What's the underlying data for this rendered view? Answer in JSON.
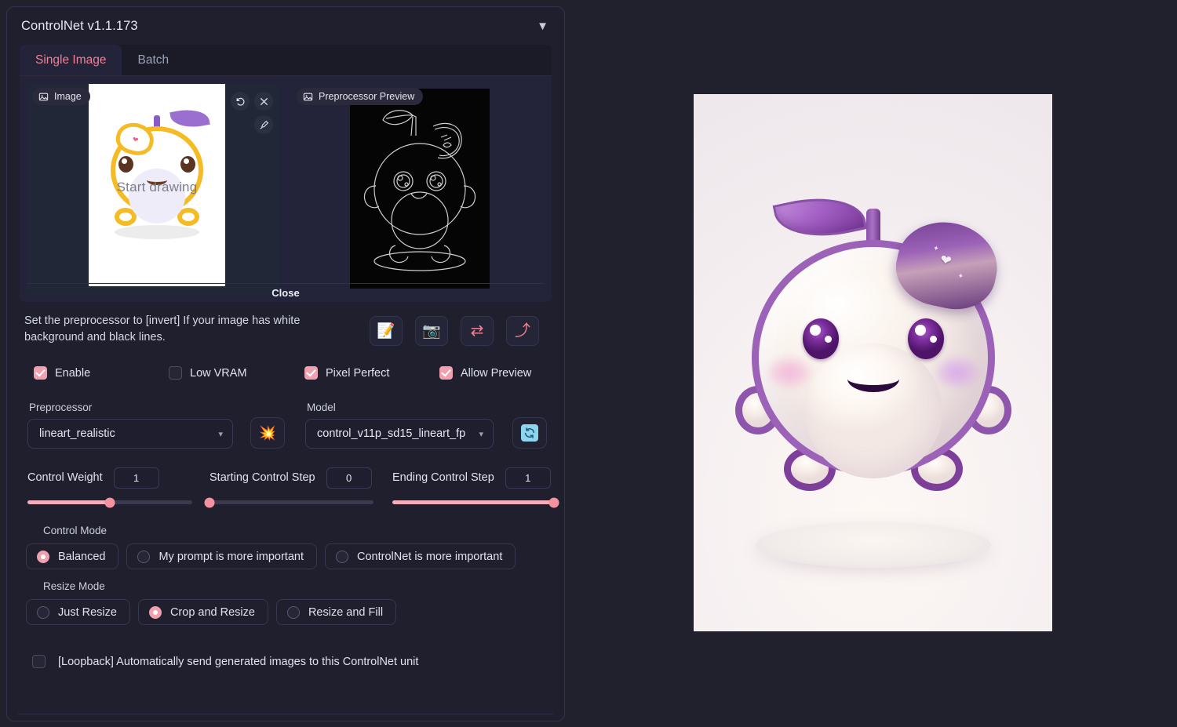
{
  "panel": {
    "title": "ControlNet v1.1.173",
    "collapse_icon": "chevron-down-icon",
    "collapse_glyph": "▼"
  },
  "tabs": [
    {
      "label": "Single Image",
      "active": true
    },
    {
      "label": "Batch",
      "active": false
    }
  ],
  "image_panel": {
    "badge": "Image",
    "canvas_placeholder": "Start drawing",
    "tools": [
      {
        "name": "undo-icon"
      },
      {
        "name": "close-icon"
      },
      {
        "name": "brush-icon"
      }
    ]
  },
  "preview_panel": {
    "badge": "Preprocessor Preview",
    "close_label": "Close"
  },
  "hint": {
    "text": "Set the preprocessor to [invert] If your image has white background and black lines."
  },
  "action_buttons": [
    {
      "name": "open-new-canvas-button",
      "glyph": "📝"
    },
    {
      "name": "webcam-button",
      "glyph": "📷"
    },
    {
      "name": "mirror-webcam-button",
      "glyph": "⇄"
    },
    {
      "name": "send-dimensions-button",
      "glyph": "⤴"
    }
  ],
  "checkboxes": [
    {
      "label": "Enable",
      "checked": true
    },
    {
      "label": "Low VRAM",
      "checked": false
    },
    {
      "label": "Pixel Perfect",
      "checked": true
    },
    {
      "label": "Allow Preview",
      "checked": true
    }
  ],
  "preprocessor": {
    "label": "Preprocessor",
    "value": "lineart_realistic"
  },
  "model": {
    "label": "Model",
    "value": "control_v11p_sd15_lineart_fp"
  },
  "run_button": {
    "name": "run-preprocessor-button",
    "glyph": "💥"
  },
  "refresh_button": {
    "name": "refresh-models-button",
    "glyph": "⟳"
  },
  "sliders": [
    {
      "label": "Control Weight",
      "value": "1",
      "percent": 50
    },
    {
      "label": "Starting Control Step",
      "value": "0",
      "percent": 0
    },
    {
      "label": "Ending Control Step",
      "value": "1",
      "percent": 100
    }
  ],
  "control_mode": {
    "label": "Control Mode",
    "options": [
      {
        "label": "Balanced",
        "selected": true
      },
      {
        "label": "My prompt is more important",
        "selected": false
      },
      {
        "label": "ControlNet is more important",
        "selected": false
      }
    ]
  },
  "resize_mode": {
    "label": "Resize Mode",
    "options": [
      {
        "label": "Just Resize",
        "selected": false
      },
      {
        "label": "Crop and Resize",
        "selected": true
      },
      {
        "label": "Resize and Fill",
        "selected": false
      }
    ]
  },
  "loopback": {
    "label": "[Loopback] Automatically send generated images to this ControlNet unit",
    "checked": false
  },
  "generated_image": {
    "name": "generated-character-image",
    "description": "3D cute round white character with purple outline, leaf stem and beret"
  },
  "colors": {
    "accent_pink": "#f0a0ae",
    "tab_active": "#f08094",
    "panel_bg": "#1f1f2d",
    "page_bg": "#21212e",
    "slider_fill": "#f3adbb",
    "character_purple": "#9b62b8",
    "thumb_outline": "#f5ba24"
  }
}
